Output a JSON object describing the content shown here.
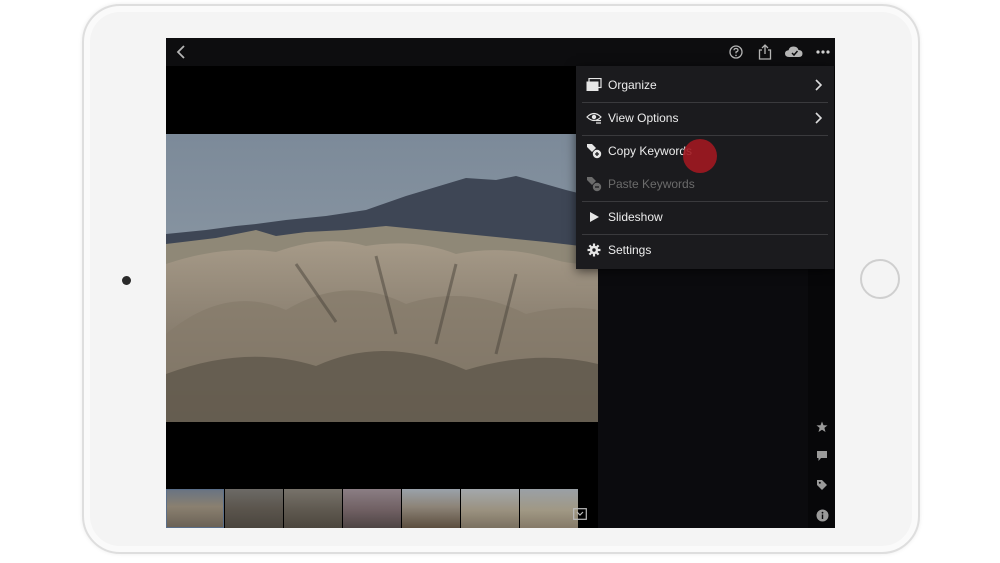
{
  "device": {
    "kind": "tablet"
  },
  "topbar": {
    "back_icon": "chevron-left-icon",
    "help_icon": "help-circle-icon",
    "share_icon": "share-icon",
    "cloud_icon": "cloud-sync-icon",
    "more_icon": "ellipsis-icon"
  },
  "menu": {
    "items": [
      {
        "label": "Organize",
        "icon": "organize-icon",
        "has_submenu": true,
        "enabled": true
      },
      {
        "label": "View Options",
        "icon": "view-options-icon",
        "has_submenu": true,
        "enabled": true
      },
      {
        "label": "Copy Keywords",
        "icon": "copy-keywords-icon",
        "has_submenu": false,
        "enabled": true
      },
      {
        "label": "Paste Keywords",
        "icon": "paste-keywords-icon",
        "has_submenu": false,
        "enabled": false
      },
      {
        "label": "Slideshow",
        "icon": "play-icon",
        "has_submenu": false,
        "enabled": true
      },
      {
        "label": "Settings",
        "icon": "gear-icon",
        "has_submenu": false,
        "enabled": true
      }
    ]
  },
  "rail": {
    "icons": [
      "star-icon",
      "comment-icon",
      "tag-icon",
      "info-icon"
    ]
  },
  "filmstrip": {
    "thumb_count": 7,
    "selected_index": 0
  },
  "colors": {
    "menu_bg": "#1b1b1e",
    "tap_indicator": "#a11820",
    "disabled_text": "#6b6b6b"
  }
}
